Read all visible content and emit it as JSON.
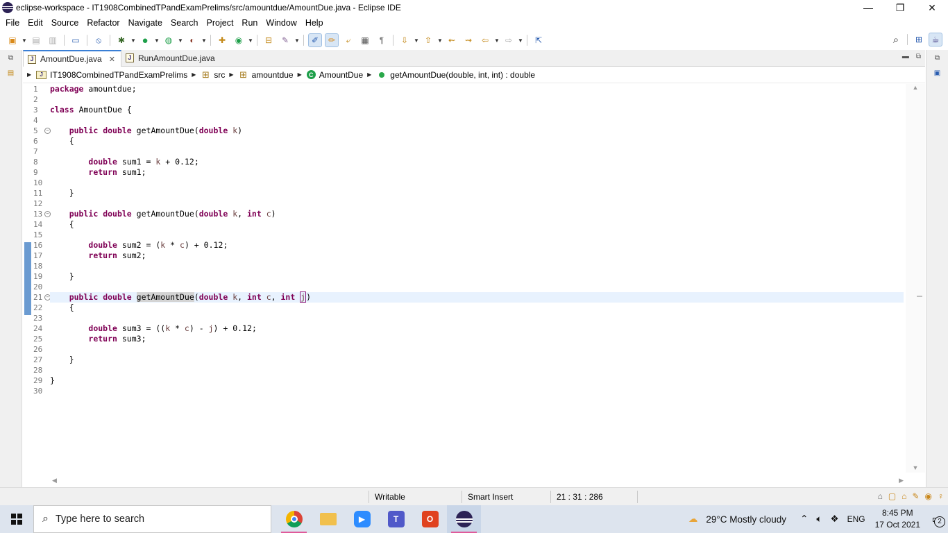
{
  "window": {
    "title": "eclipse-workspace - IT1908CombinedTPandExamPrelims/src/amountdue/AmountDue.java - Eclipse IDE",
    "minimize": "—",
    "maximize": "❐",
    "close": "✕"
  },
  "menu": [
    "File",
    "Edit",
    "Source",
    "Refactor",
    "Navigate",
    "Search",
    "Project",
    "Run",
    "Window",
    "Help"
  ],
  "tabs": [
    {
      "label": "AmountDue.java",
      "active": true,
      "close": "✕"
    },
    {
      "label": "RunAmountDue.java",
      "active": false
    }
  ],
  "breadcrumb": {
    "project": "IT1908CombinedTPandExamPrelims",
    "folder": "src",
    "package": "amountdue",
    "class": "AmountDue",
    "method": "getAmountDue(double, int, int) : double"
  },
  "editor": {
    "line_numbers": [
      "1",
      "2",
      "3",
      "4",
      "5",
      "6",
      "7",
      "8",
      "9",
      "10",
      "11",
      "12",
      "13",
      "14",
      "15",
      "16",
      "17",
      "18",
      "19",
      "20",
      "21",
      "22",
      "23",
      "24",
      "25",
      "26",
      "27",
      "28",
      "29",
      "30"
    ],
    "lines": [
      "package amountdue;",
      "",
      "class AmountDue {",
      "",
      "    public double getAmountDue(double k)",
      "    {",
      "",
      "        double sum1 = k + 0.12;",
      "        return sum1;",
      "",
      "    }",
      "",
      "    public double getAmountDue(double k, int c)",
      "    {",
      "",
      "        double sum2 = (k * c) + 0.12;",
      "        return sum2;",
      "",
      "    }",
      "",
      "    public double getAmountDue(double k, int c, int j)",
      "    {",
      "",
      "        double sum3 = ((k * c) - j) + 0.12;",
      "        return sum3;",
      "",
      "    }",
      "",
      "}",
      ""
    ],
    "fold_lines": [
      5,
      13,
      21
    ],
    "current_line": 21
  },
  "status": {
    "writable": "Writable",
    "insert_mode": "Smart Insert",
    "position": "21 : 31 : 286"
  },
  "taskbar": {
    "search_placeholder": "Type here to search",
    "weather": "29°C  Mostly cloudy",
    "language": "ENG",
    "time": "8:45 PM",
    "date": "17 Oct 2021",
    "notifications": "2"
  },
  "icons": {
    "search": "search-icon",
    "close": "close-icon"
  },
  "colors": {
    "keyword": "#7f0055",
    "variable": "#6a3e3e",
    "current_line": "#e8f2fe",
    "change_bar": "#6b9bd1",
    "tab_accent": "#3a7fd5"
  }
}
